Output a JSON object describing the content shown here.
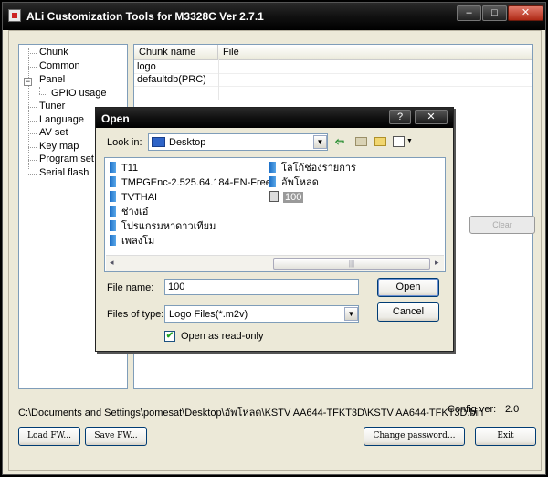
{
  "window": {
    "title": "ALi Customization Tools for M3328C  Ver 2.7.1",
    "min_glyph": "–",
    "max_glyph": "□",
    "close_glyph": "✕"
  },
  "tree": {
    "items": [
      "Chunk",
      "Common",
      "Panel",
      "GPIO usage",
      "Tuner",
      "Language",
      "AV set",
      "Key map",
      "Program set",
      "Serial flash"
    ],
    "expander": "−"
  },
  "chunk_table": {
    "columns": [
      "Chunk name",
      "File"
    ],
    "rows": [
      {
        "name": "logo",
        "file": ""
      },
      {
        "name": "defaultdb(PRC)",
        "file": ""
      }
    ]
  },
  "buttons": {
    "clear": "Clear",
    "load_fw": "Load FW...",
    "save_fw": "Save FW...",
    "change_password": "Change password...",
    "exit": "Exit"
  },
  "status": {
    "path": "C:\\Documents and Settings\\pomesat\\Desktop\\อัพโหลด\\KSTV AA644-TFKT3D\\KSTV AA644-TFKT3D.bin",
    "config_label": "Config ver:",
    "config_value": "2.0"
  },
  "dialog": {
    "title": "Open",
    "help_glyph": "?",
    "close_glyph": "✕",
    "lookin_label": "Look in:",
    "lookin_value": "Desktop",
    "files_col1": [
      "T11",
      "TMPGEnc-2.525.64.184-EN-Free",
      "TVTHAI",
      "ช่างเอ๋",
      "โปรแกรมหาดาวเทียม",
      "เพลงโม"
    ],
    "files_col2": [
      "โลโก้ช่องรายการ",
      "อัพโหลด"
    ],
    "selected_file": "100",
    "filename_label": "File name:",
    "filename_value": "100",
    "filetype_label": "Files of type:",
    "filetype_value": "Logo Files(*.m2v)",
    "readonly_label": "Open as read-only",
    "readonly_checked": "✔",
    "open_button": "Open",
    "cancel_button": "Cancel",
    "dropdown_glyph": "▼",
    "back_glyph": "⇦",
    "scroll_grip": "|||",
    "scroll_left": "◂",
    "scroll_right": "▸"
  }
}
